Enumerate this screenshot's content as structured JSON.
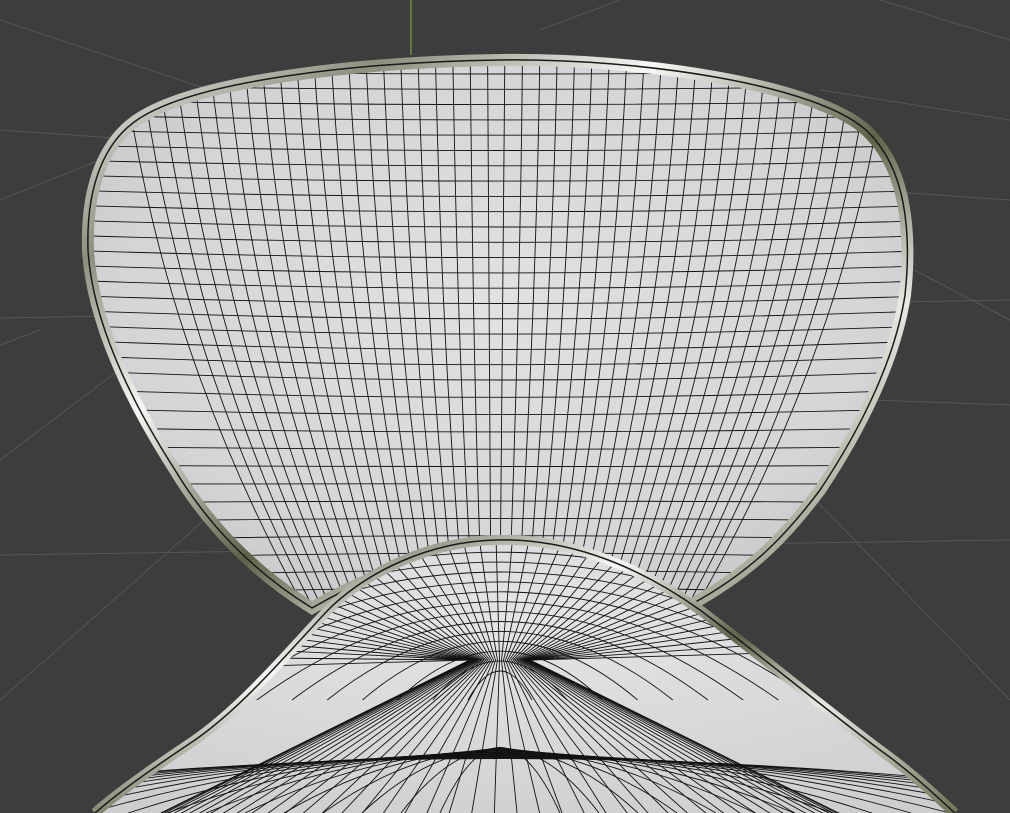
{
  "viewport": {
    "background_color": "#3d3d3d",
    "grid_color": "#555555",
    "y_axis_color": "#6f8f3f",
    "shading_mode": "solid-wireframe",
    "surface_color": "#dcdadc",
    "wire_color": "#121212",
    "rim_material": "chrome"
  },
  "model": {
    "parts": [
      "chair-backrest-shell",
      "chair-seat-shell",
      "chair-rim"
    ],
    "icons": [
      "grid-icon"
    ]
  }
}
